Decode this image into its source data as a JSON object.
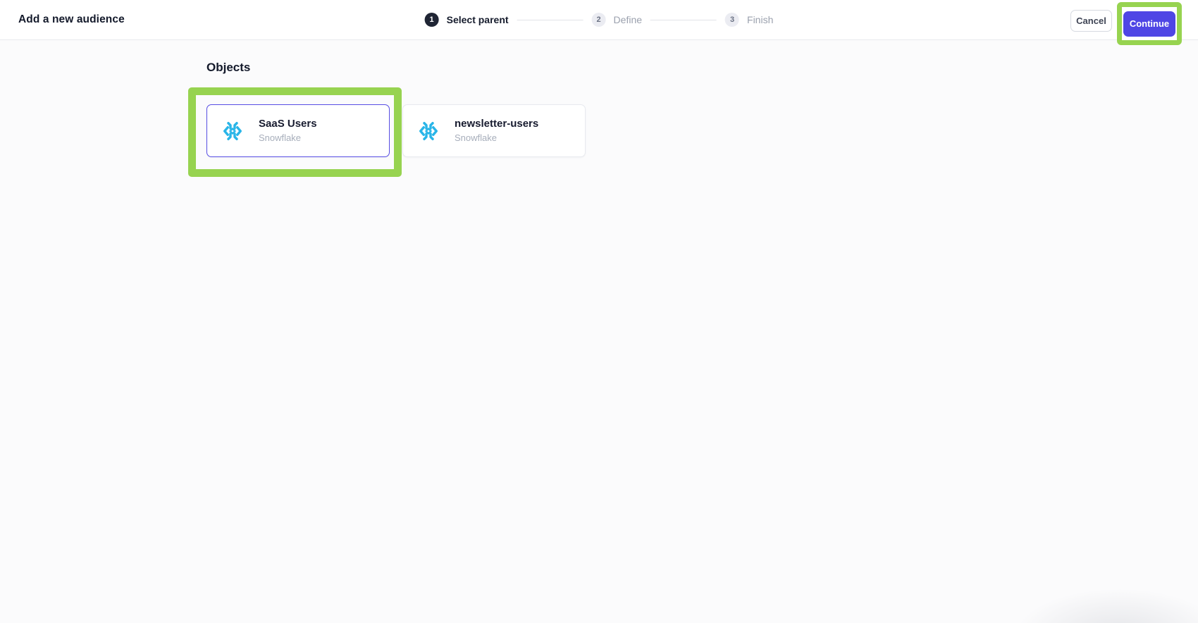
{
  "header": {
    "title": "Add a new audience",
    "steps": [
      {
        "number": "1",
        "label": "Select parent",
        "state": "active"
      },
      {
        "number": "2",
        "label": "Define",
        "state": "upcoming"
      },
      {
        "number": "3",
        "label": "Finish",
        "state": "upcoming"
      }
    ],
    "cancel_label": "Cancel",
    "continue_label": "Continue"
  },
  "main": {
    "section_title": "Objects",
    "cards": [
      {
        "title": "SaaS Users",
        "subtitle": "Snowflake",
        "icon": "snowflake-icon",
        "selected": true
      },
      {
        "title": "newsletter-users",
        "subtitle": "Snowflake",
        "icon": "snowflake-icon",
        "selected": false
      }
    ]
  },
  "annotations": {
    "highlight_color": "#97D350",
    "highlighted_elements": [
      "saas-users-card",
      "continue-button"
    ]
  },
  "colors": {
    "primary_button": "#4F46E5",
    "selected_card_border": "#574DE4",
    "snowflake_blue": "#29B5E8",
    "active_step_circle": "#1F2534"
  }
}
